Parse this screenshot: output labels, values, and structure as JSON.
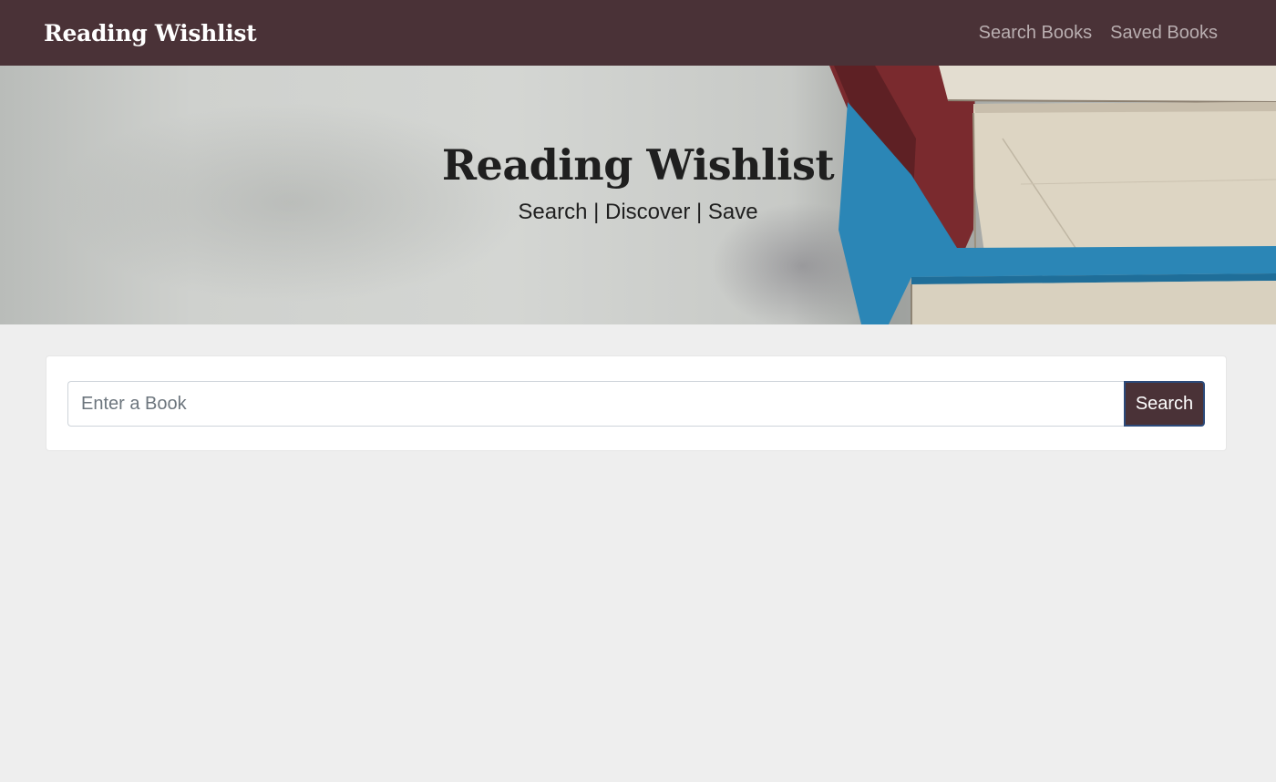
{
  "navbar": {
    "brand": "Reading Wishlist",
    "links": [
      {
        "label": "Search Books"
      },
      {
        "label": "Saved Books"
      }
    ]
  },
  "hero": {
    "title": "Reading Wishlist",
    "subtitle": "Search | Discover | Save"
  },
  "search": {
    "placeholder": "Enter a Book",
    "value": "",
    "button_label": "Search"
  },
  "colors": {
    "navbar_bg": "#4a3237",
    "page_bg": "#eeeeee",
    "button_bg": "#4a3237",
    "button_border": "#2c4a7a"
  }
}
